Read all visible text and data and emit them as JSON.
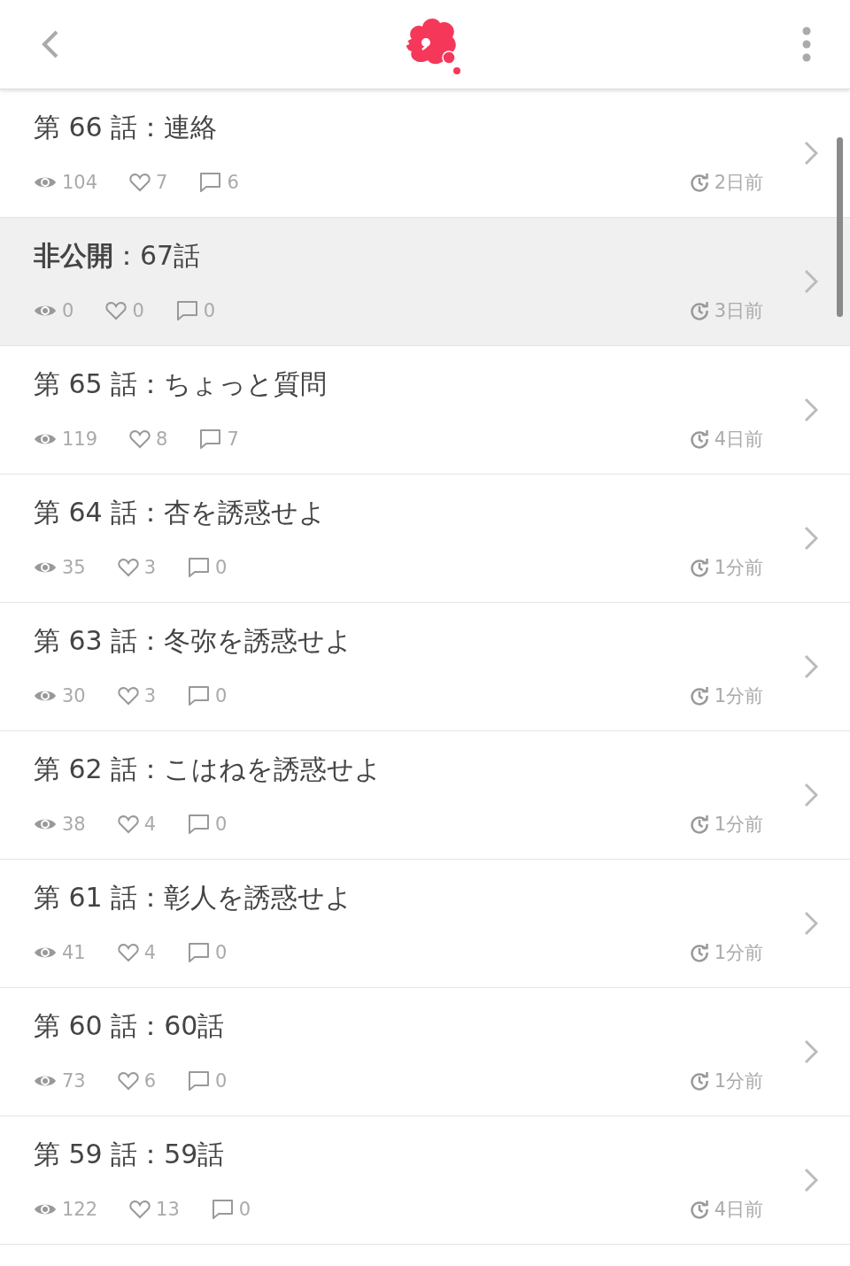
{
  "episodes": [
    {
      "title": "第 66 話：連絡",
      "private": false,
      "views": "104",
      "likes": "7",
      "comments": "6",
      "updated": "2日前"
    },
    {
      "title": "**非公開**：67話",
      "private": true,
      "views": "0",
      "likes": "0",
      "comments": "0",
      "updated": "3日前"
    },
    {
      "title": "第 65 話：ちょっと質問",
      "private": false,
      "views": "119",
      "likes": "8",
      "comments": "7",
      "updated": "4日前"
    },
    {
      "title": "第 64 話：杏を誘惑せよ",
      "private": false,
      "views": "35",
      "likes": "3",
      "comments": "0",
      "updated": "1分前"
    },
    {
      "title": "第 63 話：冬弥を誘惑せよ",
      "private": false,
      "views": "30",
      "likes": "3",
      "comments": "0",
      "updated": "1分前"
    },
    {
      "title": "第 62 話：こはねを誘惑せよ",
      "private": false,
      "views": "38",
      "likes": "4",
      "comments": "0",
      "updated": "1分前"
    },
    {
      "title": "第 61 話：彰人を誘惑せよ",
      "private": false,
      "views": "41",
      "likes": "4",
      "comments": "0",
      "updated": "1分前"
    },
    {
      "title": "第 60 話：60話",
      "private": false,
      "views": "73",
      "likes": "6",
      "comments": "0",
      "updated": "1分前"
    },
    {
      "title": "第 59 話：59話",
      "private": false,
      "views": "122",
      "likes": "13",
      "comments": "0",
      "updated": "4日前"
    }
  ]
}
